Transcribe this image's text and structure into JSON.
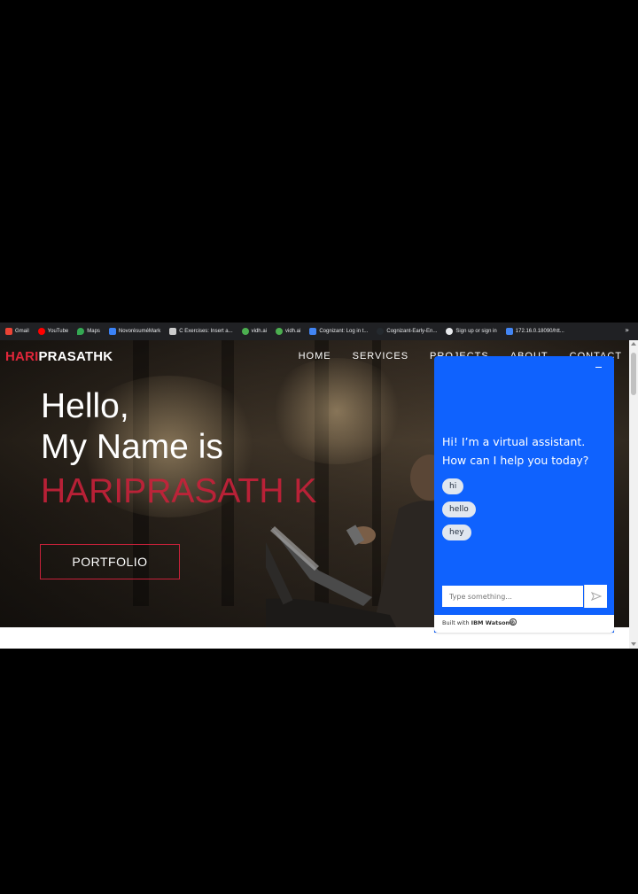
{
  "bookmarks": [
    {
      "label": "Gmail",
      "icon": "gmail-icon",
      "color": "#ea4335"
    },
    {
      "label": "YouTube",
      "icon": "youtube-icon",
      "color": "#ff0000"
    },
    {
      "label": "Maps",
      "icon": "maps-icon",
      "color": "#34a853"
    },
    {
      "label": "NovorésuméMark",
      "icon": "novoresume-icon",
      "color": "#3b82f6"
    },
    {
      "label": "C Exercises: Insert a...",
      "icon": "w3-icon",
      "color": "#cccccc"
    },
    {
      "label": "vidh.ai",
      "icon": "vidh-icon",
      "color": "#4caf50"
    },
    {
      "label": "vidh.ai",
      "icon": "vidh-icon",
      "color": "#4caf50"
    },
    {
      "label": "Cognizant: Log in t...",
      "icon": "cognizant-icon",
      "color": "#4285f4"
    },
    {
      "label": "Cognizant-Early-En...",
      "icon": "github-icon",
      "color": "#24292e"
    },
    {
      "label": "Sign up or sign in",
      "icon": "globe-icon",
      "color": "#e8eaed"
    },
    {
      "label": "172.16.0.18090/htt...",
      "icon": "s-icon",
      "color": "#4285f4"
    }
  ],
  "site": {
    "logo_part1": "HARI",
    "logo_part2": "PRASATHK",
    "nav": [
      "HOME",
      "SERVICES",
      "PROJECTS",
      "ABOUT",
      "CONTACT"
    ],
    "greeting_line1": "Hello,",
    "greeting_line2": "My Name is",
    "name": "HARIPRASATH K",
    "portfolio_button": "PORTFOLIO"
  },
  "chat": {
    "welcome": "Hi! I’m a virtual assistant. How can I help you today?",
    "suggestions": [
      "hi",
      "hello",
      "hey"
    ],
    "input_placeholder": "Type something...",
    "footer_prefix": "Built with ",
    "footer_brand": "IBM Watson®"
  },
  "colors": {
    "accent_red": "#c8213a",
    "chat_blue": "#0f62fe"
  }
}
